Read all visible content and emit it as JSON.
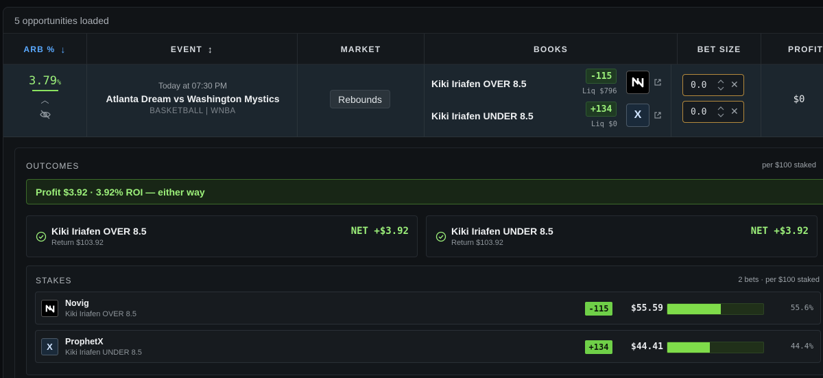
{
  "topbar": {
    "status": "5 opportunities loaded"
  },
  "columns": {
    "arb": "ARB %",
    "event": "EVENT",
    "market": "MARKET",
    "books": "BOOKS",
    "bet_size": "BET SIZE",
    "profit": "PROFIT"
  },
  "row": {
    "arb_value": "3.79",
    "arb_unit": "%",
    "event_time": "Today at 07:30 PM",
    "event_name": "Atlanta Dream vs Washington Mystics",
    "event_sport": "BASKETBALL | WNBA",
    "market": "Rebounds",
    "legs": [
      {
        "selection": "Kiki Iriafen OVER 8.5",
        "odds": "-115",
        "liquidity": "Liq $796",
        "book_icon": "novig-logo",
        "bet": "0.0"
      },
      {
        "selection": "Kiki Iriafen UNDER 8.5",
        "odds": "+134",
        "liquidity": "Liq $0",
        "book_icon": "prophetx-logo",
        "bet": "0.0"
      }
    ],
    "profit": "$0"
  },
  "outcomes": {
    "title": "OUTCOMES",
    "note": "per $100 staked",
    "banner": "Profit $3.92 · 3.92% ROI — either way",
    "items": [
      {
        "name": "Kiki Iriafen OVER 8.5",
        "return": "Return $103.92",
        "net": "NET +$3.92"
      },
      {
        "name": "Kiki Iriafen UNDER 8.5",
        "return": "Return $103.92",
        "net": "NET +$3.92"
      }
    ]
  },
  "stakes": {
    "title": "STAKES",
    "note": "2 bets · per $100 staked",
    "items": [
      {
        "book": "Novig",
        "selection": "Kiki Iriafen OVER 8.5",
        "odds": "-115",
        "amount": "$55.59",
        "pct_label": "55.6%",
        "fraction": 0.556
      },
      {
        "book": "ProphetX",
        "selection": "Kiki Iriafen UNDER 8.5",
        "odds": "+134",
        "amount": "$44.41",
        "pct_label": "44.4%",
        "fraction": 0.444
      }
    ]
  },
  "colors": {
    "accent_green": "#9cf07a",
    "sort_blue": "#5aa9ff",
    "input_border": "#b3893d"
  }
}
